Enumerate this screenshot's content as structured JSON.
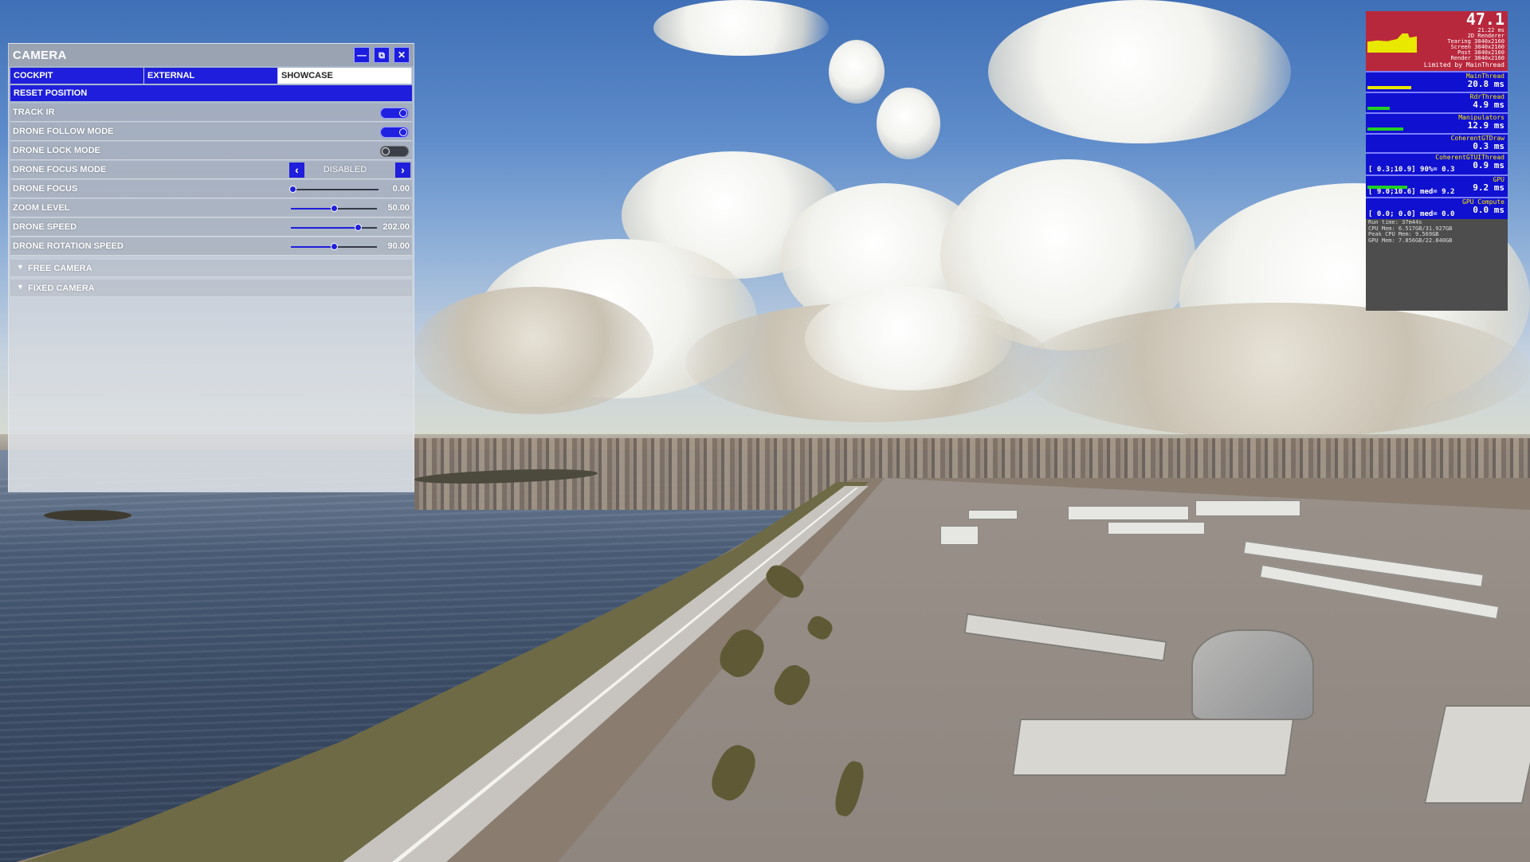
{
  "camera_panel": {
    "title": "CAMERA",
    "tabs": [
      {
        "label": "COCKPIT",
        "active": false
      },
      {
        "label": "EXTERNAL",
        "active": false
      },
      {
        "label": "SHOWCASE",
        "active": true
      }
    ],
    "reset_label": "RESET POSITION",
    "toggles": [
      {
        "label": "TRACK IR",
        "on": true
      },
      {
        "label": "DRONE FOLLOW MODE",
        "on": true
      },
      {
        "label": "DRONE LOCK MODE",
        "on": false
      }
    ],
    "focus_mode": {
      "label": "DRONE FOCUS MODE",
      "value": "DISABLED"
    },
    "sliders": [
      {
        "label": "DRONE FOCUS",
        "value": "0.00",
        "fraction": 0.0
      },
      {
        "label": "ZOOM LEVEL",
        "value": "50.00",
        "fraction": 0.5
      },
      {
        "label": "DRONE SPEED",
        "value": "202.00",
        "fraction": 0.78
      },
      {
        "label": "DRONE ROTATION SPEED",
        "value": "90.00",
        "fraction": 0.5
      }
    ],
    "sections": [
      {
        "label": "FREE CAMERA",
        "icon": "chevron-down-icon"
      },
      {
        "label": "FIXED CAMERA",
        "icon": "chevron-down-icon"
      }
    ],
    "accent_color": "#1e1edc"
  },
  "perf_overlay": {
    "fps": "47.1",
    "fps_lines": [
      "21.22 ms",
      "2D Renderer",
      "Tearing 3840x2160",
      "Screen 3840x2160",
      "Post 3840x2160",
      "Render 3840x2160"
    ],
    "limit": "Limited by MainThread",
    "threads": [
      {
        "name": "MainThread",
        "ms": "20.8 ms",
        "bar": 0.55,
        "bar_color": "yellow"
      },
      {
        "name": "RdrThread",
        "ms": "4.9 ms",
        "bar": 0.28,
        "bar_color": "green"
      },
      {
        "name": "Manipulators",
        "ms": "12.9 ms",
        "bar": 0.45,
        "bar_color": "green"
      },
      {
        "name": "CoherentGTDraw",
        "ms": "0.3 ms",
        "bar": 0.0,
        "bar_color": "green"
      },
      {
        "name": "CoherentGTUIThread",
        "ms": "0.9 ms",
        "range": "[ 0.3;10.9] 90%= 0.3",
        "bar": 0.0,
        "bar_color": "green"
      },
      {
        "name": "GPU",
        "ms": "9.2 ms",
        "range": "[ 9.0;10.6] med= 9.2",
        "bar": 0.5,
        "bar_color": "green"
      },
      {
        "name": "GPU Compute",
        "ms": "0.0 ms",
        "range": "[ 0.0; 0.0] med= 0.0",
        "bar": 0.0,
        "bar_color": "green"
      }
    ],
    "memory": [
      "Run time: 37m44s",
      "CPU Mem: 6.517GB/31.927GB",
      "Peak CPU Mem: 9.569GB",
      "GPU Mem: 7.856GB/22.840GB"
    ]
  }
}
